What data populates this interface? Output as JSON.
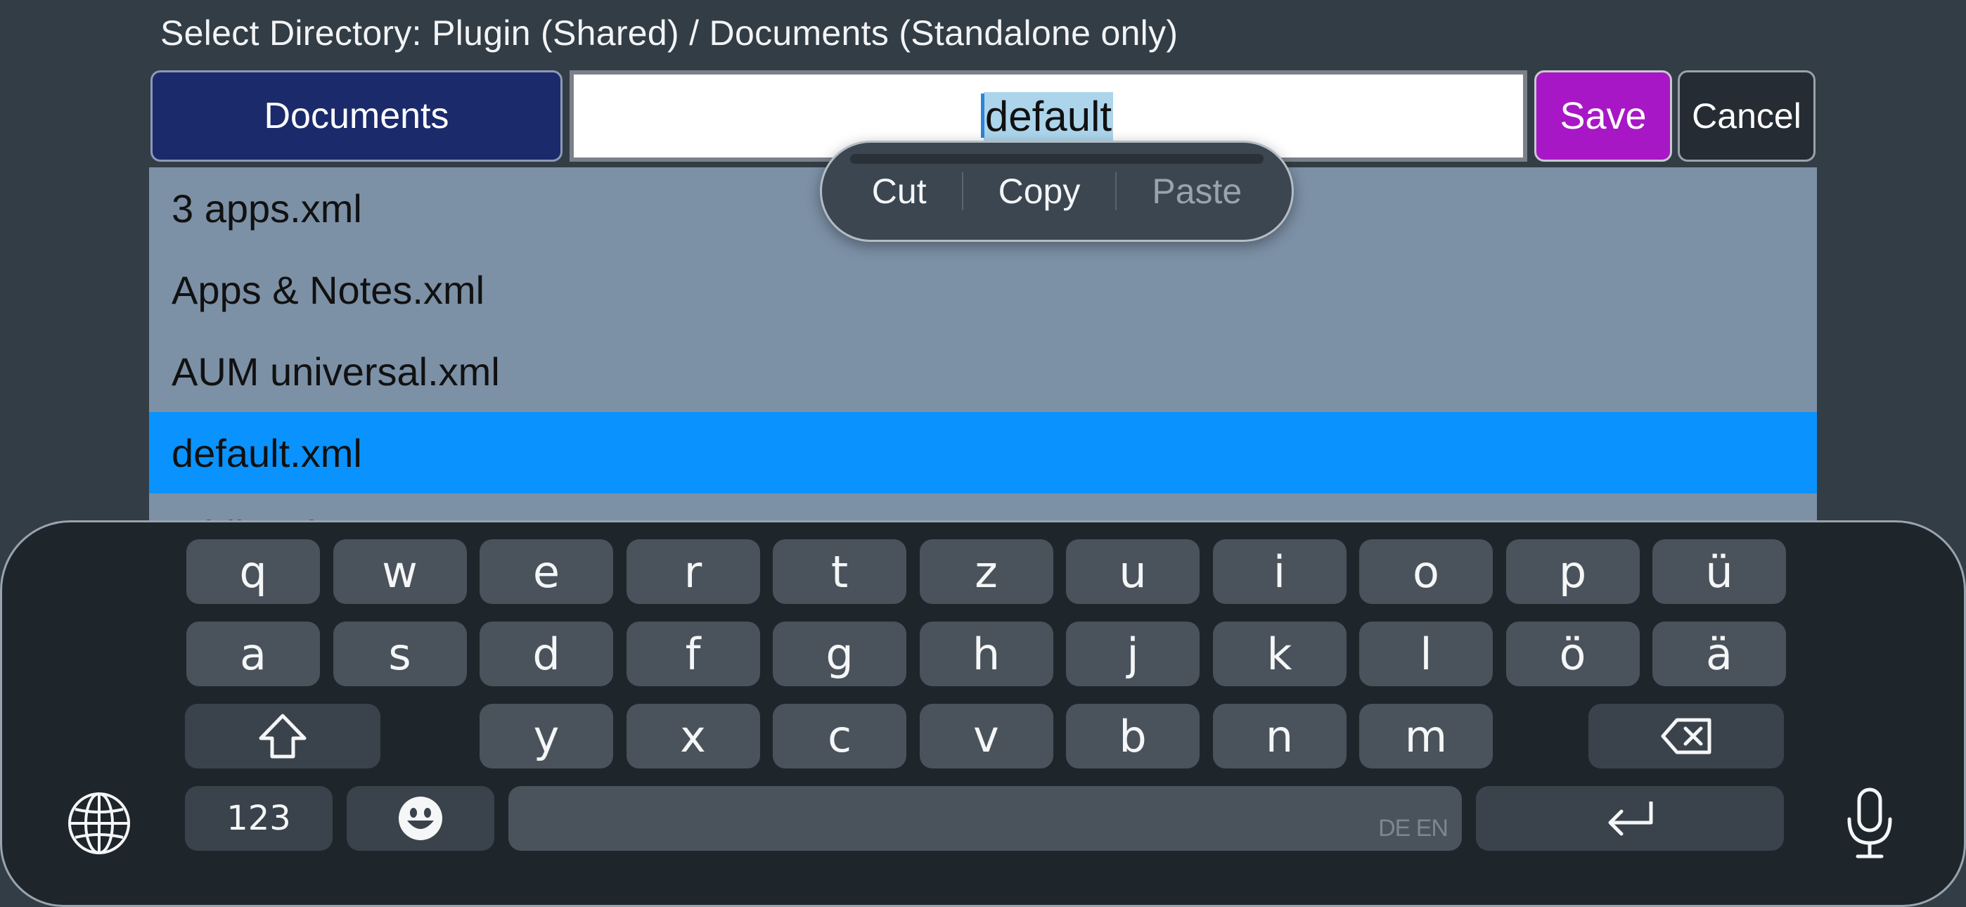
{
  "header": {
    "title": "Select Directory: Plugin (Shared) / Documents (Standalone only)"
  },
  "toolbar": {
    "directory_label": "Documents",
    "filename_value": "default",
    "save_label": "Save",
    "cancel_label": "Cancel"
  },
  "files": [
    {
      "name": "3 apps.xml",
      "selected": false
    },
    {
      "name": "Apps & Notes.xml",
      "selected": false
    },
    {
      "name": "AUM universal.xml",
      "selected": false
    },
    {
      "name": "default.xml",
      "selected": true
    },
    {
      "name": "midi.xml",
      "selected": false
    }
  ],
  "context_menu": {
    "cut": "Cut",
    "copy": "Copy",
    "paste": "Paste"
  },
  "keyboard": {
    "row1": [
      "q",
      "w",
      "e",
      "r",
      "t",
      "z",
      "u",
      "i",
      "o",
      "p",
      "ü"
    ],
    "row2": [
      "a",
      "s",
      "d",
      "f",
      "g",
      "h",
      "j",
      "k",
      "l",
      "ö",
      "ä"
    ],
    "row3": [
      "y",
      "x",
      "c",
      "v",
      "b",
      "n",
      "m"
    ],
    "numbers_label": "123",
    "space_language": "DE EN",
    "icons": [
      "globe-icon",
      "shift-icon",
      "backspace-icon",
      "emoji-icon",
      "return-icon",
      "microphone-icon"
    ]
  },
  "colors": {
    "background": "#333d45",
    "directory_button": "#1b2a6b",
    "save_button": "#a817c6",
    "selected_row": "#0a93fe",
    "list_background": "#7c90a6"
  }
}
